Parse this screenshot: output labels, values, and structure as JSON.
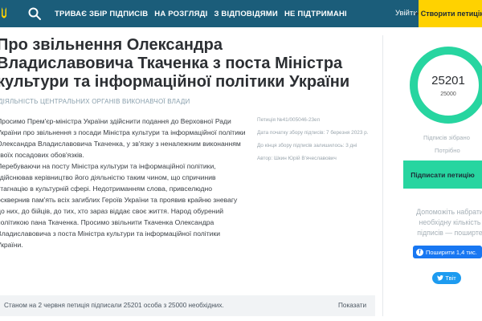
{
  "header": {
    "nav": [
      "ТРИВАЄ ЗБІР ПІДПИСІВ",
      "НА РОЗГЛЯДІ",
      "З ВІДПОВІДЯМИ",
      "НЕ ПІДТРИМАНІ"
    ],
    "login_label": "Увійти",
    "create_label": "+ Створити петицію"
  },
  "petition": {
    "title": "Про звільнення Олександра Владиславовича Ткаченка з поста Міністра культури та інформаційної політики України",
    "category": "ДІЯЛЬНІСТЬ ЦЕНТРАЛЬНИХ ОРГАНІВ ВИКОНАВЧОЇ ВЛАДИ",
    "paragraphs": [
      "Просимо Прем'єр-міністра України здійснити подання до Верховної Ради України про звільнення з посади Міністра культури та інформаційної політики Олександра Владиславовича Ткаченка, у зв'язку з неналежним виконанням своїх посадових обов'язків.",
      "Перебуваючи на посту Міністра культури та інформаційної політики, здійснював керівництво його діяльністю таким чином, що спричинив стагнацію в культурній сфері. Недотриманням слова, привселюдно осквернив пам'ять всіх загиблих Героїв України та проявив крайню зневагу до них, до бійців, до тих, хто зараз віддає своє життя. Народ обурений політикою пана Ткаченка. Просимо звільнити Ткаченка Олександра Владиславовича з поста Міністра культури та інформаційної політики України."
    ],
    "meta": {
      "number": "Петиція №41/005046-23еп",
      "start_date": "Дата початку збору підписів: 7 березня 2023 р.",
      "days_left": "До кінця збору підписів залишилось: 3 дні",
      "author": "Автор: Шкин Юрій В'ячеславович"
    },
    "status_text": "Станом на 2 червня петиція підписали 25201 особа з 25000 необхідних.",
    "show_label": "Показати"
  },
  "sidebar": {
    "count": "25201",
    "target": "25000",
    "progress_fraction": 1.0,
    "collected_label": "Підписів зібрано",
    "needed_label": "Потрібно",
    "sign_label": "Підписати петицію",
    "help_text": "Допоможіть набрати необхідну кількість підписів — поширте",
    "fb_label": "Поширити 1,4 тис.",
    "tw_label": "Твіт"
  },
  "colors": {
    "header_bg": "#1b5d7a",
    "accent_yellow": "#ffd200",
    "progress_green": "#27d5a0",
    "facebook_blue": "#1877f2",
    "twitter_blue": "#1d9bf0"
  }
}
